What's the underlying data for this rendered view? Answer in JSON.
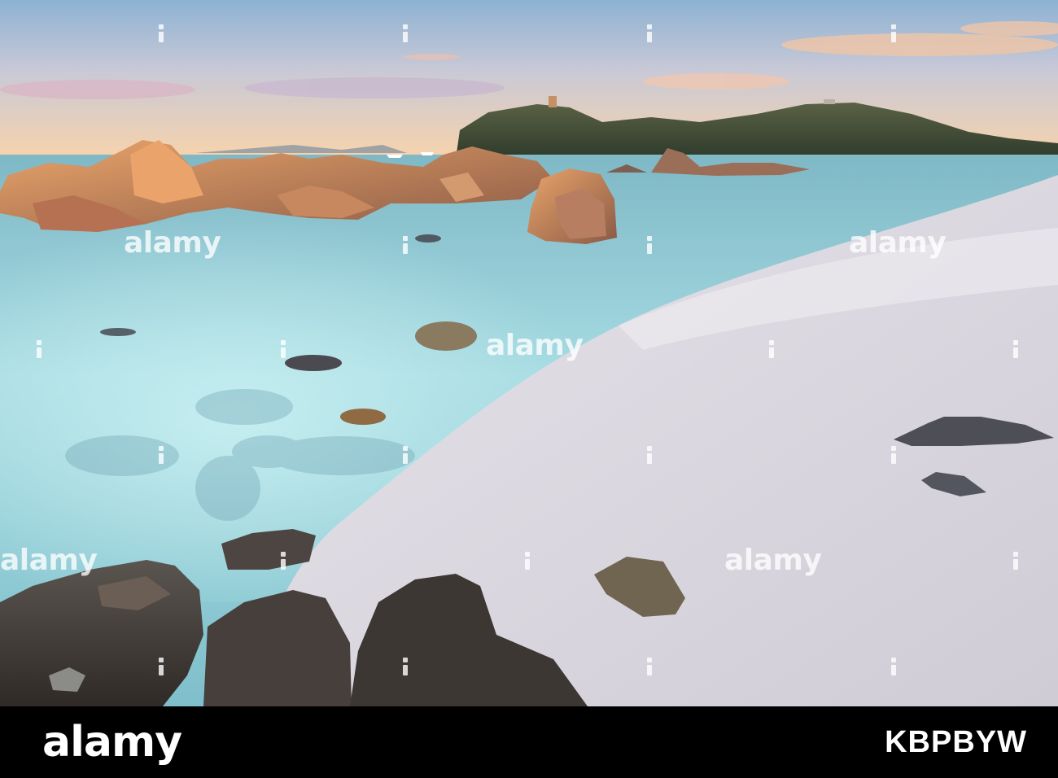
{
  "photo": {
    "scene": "rocky-beach-at-sunset",
    "colors": {
      "sky_top": "#8fb3d1",
      "sky_bottom": "#f6cfa9",
      "water": "#9fd3db",
      "sand": "#ddd9df",
      "rock": "#6e5548",
      "hill": "#3c4a36"
    }
  },
  "watermarks": {
    "text": "alamy",
    "icon": "alamy-mark-icon"
  },
  "footer": {
    "logo": "alamy",
    "image_id": "KBPBYW"
  }
}
